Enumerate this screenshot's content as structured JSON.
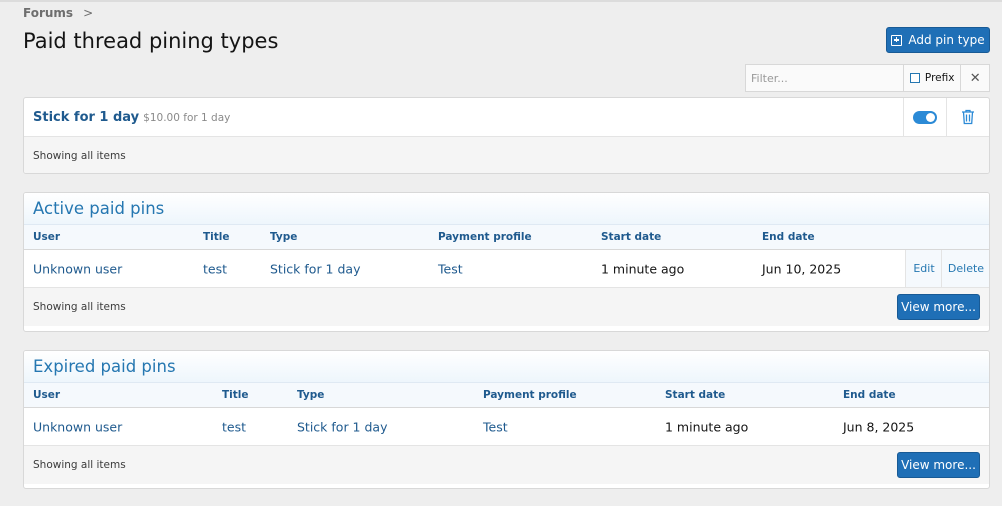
{
  "breadcrumb": {
    "item": "Forums",
    "separator": ">"
  },
  "page_title": "Paid thread pining types",
  "add_button_label": "Add pin type",
  "filter": {
    "placeholder": "Filter...",
    "prefix_label": "Prefix",
    "clear_glyph": "✕"
  },
  "pin_types": {
    "items": [
      {
        "name": "Stick for 1 day",
        "price": "$10.00 for 1 day",
        "enabled": true
      }
    ],
    "footer": "Showing all items"
  },
  "active_pins": {
    "title": "Active paid pins",
    "columns": [
      "User",
      "Title",
      "Type",
      "Payment profile",
      "Start date",
      "End date"
    ],
    "rows": [
      {
        "user": "Unknown user",
        "title": "test",
        "type": "Stick for 1 day",
        "payment_profile": "Test",
        "start_date": "1 minute ago",
        "end_date": "Jun 10, 2025",
        "edit": "Edit",
        "delete": "Delete"
      }
    ],
    "footer": "Showing all items",
    "view_more": "View more..."
  },
  "expired_pins": {
    "title": "Expired paid pins",
    "columns": [
      "User",
      "Title",
      "Type",
      "Payment profile",
      "Start date",
      "End date"
    ],
    "rows": [
      {
        "user": "Unknown user",
        "title": "test",
        "type": "Stick for 1 day",
        "payment_profile": "Test",
        "start_date": "1 minute ago",
        "end_date": "Jun 8, 2025"
      }
    ],
    "footer": "Showing all items",
    "view_more": "View more..."
  },
  "colors": {
    "accent": "#2577b1",
    "button": "#1f6fb6",
    "link": "#1f5a8e",
    "background": "#eeeeee"
  }
}
